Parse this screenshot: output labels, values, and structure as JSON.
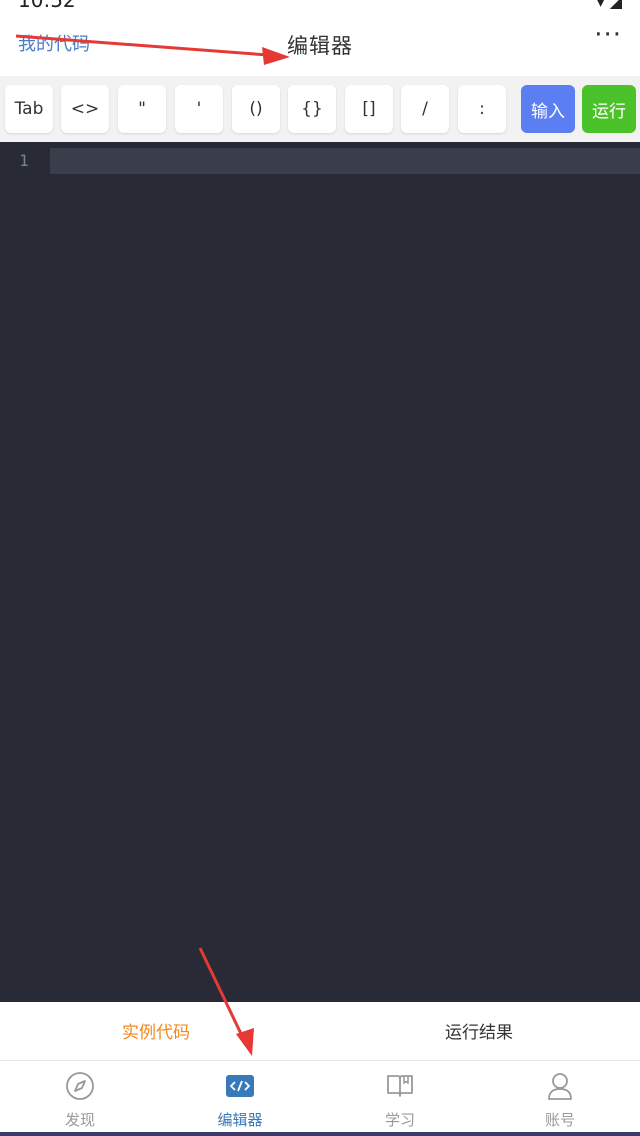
{
  "status": {
    "time": "10:52",
    "icons": "▾ ◢"
  },
  "header": {
    "left_link": "我的代码",
    "title": "编辑器",
    "more": "···"
  },
  "toolbar": {
    "keys": [
      "Tab",
      "<>",
      "\"",
      "'",
      "()",
      "{}",
      "[]",
      "/",
      ":"
    ],
    "input_label": "输入",
    "run_label": "运行",
    "colors": {
      "input": "#5b7ef2",
      "run": "#4cc22a"
    }
  },
  "editor": {
    "line_number": "1",
    "background": "#282a36"
  },
  "result_tabs": {
    "example": "实例代码",
    "result": "运行结果",
    "active_color": "#f08a1c"
  },
  "tabbar": {
    "items": [
      {
        "label": "发现",
        "icon": "compass-icon"
      },
      {
        "label": "编辑器",
        "icon": "code-icon"
      },
      {
        "label": "学习",
        "icon": "book-icon"
      },
      {
        "label": "账号",
        "icon": "user-icon"
      }
    ],
    "active_color": "#3a79b8"
  }
}
